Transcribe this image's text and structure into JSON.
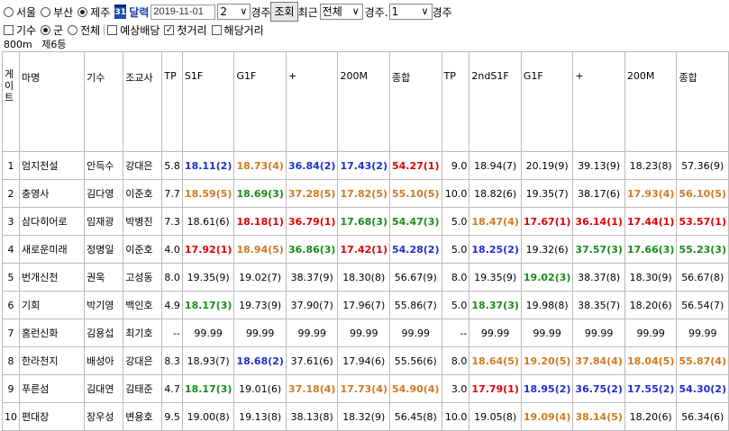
{
  "filters": {
    "regions": [
      "서울",
      "부산",
      "제주"
    ],
    "region_selected": "제주",
    "calendar_icon_text": "31",
    "calendar_link": "달력",
    "date": "2019-11-01",
    "race_no": "2",
    "race_suffix": "경주",
    "search_button": "조회",
    "recent_label": "최근",
    "recent_value": "전체",
    "race_count_label": "경주.",
    "race_count_value": "1",
    "race_count_suffix": "경주",
    "groups": [
      "기수",
      "군",
      "전체"
    ],
    "group_selected": "군",
    "checks": [
      {
        "label": "예상배당",
        "checked": false
      },
      {
        "label": "첫거리",
        "checked": true
      },
      {
        "label": "해당거리",
        "checked": false
      }
    ]
  },
  "race_info": {
    "distance": "800m",
    "grade": "제6등"
  },
  "colors": {
    "red": "#e00000",
    "orange": "#d07a20",
    "blue": "#1b2fd0",
    "green": "#1a8a1a",
    "normal": "#000000"
  },
  "table": {
    "headers": [
      "게이트",
      "마명",
      "기수",
      "조교사",
      "TP",
      "S1F",
      "G1F",
      "+",
      "200M",
      "종합",
      "TP",
      "2ndS1F",
      "G1F",
      "+",
      "200M",
      "종합"
    ],
    "rows": [
      {
        "gate": "1",
        "name": "엄지전설",
        "jockey": "안득수",
        "trainer": "강대은",
        "tp": "5.8",
        "tp2": "9.0",
        "cells": [
          [
            "18.11(2)",
            "blue"
          ],
          [
            "18.73(4)",
            "orange"
          ],
          [
            "36.84(2)",
            "blue"
          ],
          [
            "17.43(2)",
            "blue"
          ],
          [
            "54.27(1)",
            "red"
          ],
          [
            "18.94(7)",
            "normal"
          ],
          [
            "20.19(9)",
            "normal"
          ],
          [
            "39.13(9)",
            "normal"
          ],
          [
            "18.23(8)",
            "normal"
          ],
          [
            "57.36(9)",
            "normal"
          ]
        ]
      },
      {
        "gate": "2",
        "name": "충영사",
        "jockey": "김다영",
        "trainer": "이준호",
        "tp": "7.7",
        "tp2": "10.0",
        "cells": [
          [
            "18.59(5)",
            "orange"
          ],
          [
            "18.69(3)",
            "green"
          ],
          [
            "37.28(5)",
            "orange"
          ],
          [
            "17.82(5)",
            "orange"
          ],
          [
            "55.10(5)",
            "orange"
          ],
          [
            "18.82(6)",
            "normal"
          ],
          [
            "19.35(7)",
            "normal"
          ],
          [
            "38.17(6)",
            "normal"
          ],
          [
            "17.93(4)",
            "orange"
          ],
          [
            "56.10(5)",
            "orange"
          ]
        ]
      },
      {
        "gate": "3",
        "name": "삼다히어로",
        "jockey": "임재광",
        "trainer": "박병진",
        "tp": "7.3",
        "tp2": "5.0",
        "cells": [
          [
            "18.61(6)",
            "normal"
          ],
          [
            "18.18(1)",
            "red"
          ],
          [
            "36.79(1)",
            "red"
          ],
          [
            "17.68(3)",
            "green"
          ],
          [
            "54.47(3)",
            "green"
          ],
          [
            "18.47(4)",
            "orange"
          ],
          [
            "17.67(1)",
            "red"
          ],
          [
            "36.14(1)",
            "red"
          ],
          [
            "17.44(1)",
            "red"
          ],
          [
            "53.57(1)",
            "red"
          ]
        ]
      },
      {
        "gate": "4",
        "name": "새로운미래",
        "jockey": "정명일",
        "trainer": "이준호",
        "tp": "4.0",
        "tp2": "5.0",
        "cells": [
          [
            "17.92(1)",
            "red"
          ],
          [
            "18.94(5)",
            "orange"
          ],
          [
            "36.86(3)",
            "green"
          ],
          [
            "17.42(1)",
            "red"
          ],
          [
            "54.28(2)",
            "blue"
          ],
          [
            "18.25(2)",
            "blue"
          ],
          [
            "19.32(6)",
            "normal"
          ],
          [
            "37.57(3)",
            "green"
          ],
          [
            "17.66(3)",
            "green"
          ],
          [
            "55.23(3)",
            "green"
          ]
        ]
      },
      {
        "gate": "5",
        "name": "번개신천",
        "jockey": "권욱",
        "trainer": "고성동",
        "tp": "8.0",
        "tp2": "8.0",
        "cells": [
          [
            "19.35(9)",
            "normal"
          ],
          [
            "19.02(7)",
            "normal"
          ],
          [
            "38.37(9)",
            "normal"
          ],
          [
            "18.30(8)",
            "normal"
          ],
          [
            "56.67(9)",
            "normal"
          ],
          [
            "19.35(9)",
            "normal"
          ],
          [
            "19.02(3)",
            "green"
          ],
          [
            "38.37(8)",
            "normal"
          ],
          [
            "18.30(9)",
            "normal"
          ],
          [
            "56.67(8)",
            "normal"
          ]
        ]
      },
      {
        "gate": "6",
        "name": "기회",
        "jockey": "박기영",
        "trainer": "백인호",
        "tp": "4.9",
        "tp2": "5.0",
        "cells": [
          [
            "18.17(3)",
            "green"
          ],
          [
            "19.73(9)",
            "normal"
          ],
          [
            "37.90(7)",
            "normal"
          ],
          [
            "17.96(7)",
            "normal"
          ],
          [
            "55.86(7)",
            "normal"
          ],
          [
            "18.37(3)",
            "green"
          ],
          [
            "19.98(8)",
            "normal"
          ],
          [
            "38.35(7)",
            "normal"
          ],
          [
            "18.20(6)",
            "normal"
          ],
          [
            "56.54(7)",
            "normal"
          ]
        ]
      },
      {
        "gate": "7",
        "name": "홈런신화",
        "jockey": "김용섭",
        "trainer": "최기호",
        "tp": "--",
        "tp2": "--",
        "cells": [
          [
            "99.99",
            "normal"
          ],
          [
            "99.99",
            "normal"
          ],
          [
            "99.99",
            "normal"
          ],
          [
            "99.99",
            "normal"
          ],
          [
            "99.99",
            "normal"
          ],
          [
            "99.99",
            "normal"
          ],
          [
            "99.99",
            "normal"
          ],
          [
            "99.99",
            "normal"
          ],
          [
            "99.99",
            "normal"
          ],
          [
            "99.99",
            "normal"
          ]
        ]
      },
      {
        "gate": "8",
        "name": "한라천지",
        "jockey": "배성아",
        "trainer": "강대은",
        "tp": "8.3",
        "tp2": "8.0",
        "cells": [
          [
            "18.93(7)",
            "normal"
          ],
          [
            "18.68(2)",
            "blue"
          ],
          [
            "37.61(6)",
            "normal"
          ],
          [
            "17.94(6)",
            "normal"
          ],
          [
            "55.56(6)",
            "normal"
          ],
          [
            "18.64(5)",
            "orange"
          ],
          [
            "19.20(5)",
            "orange"
          ],
          [
            "37.84(4)",
            "orange"
          ],
          [
            "18.04(5)",
            "orange"
          ],
          [
            "55.87(4)",
            "orange"
          ]
        ]
      },
      {
        "gate": "9",
        "name": "푸른섬",
        "jockey": "김대연",
        "trainer": "김태준",
        "tp": "4.7",
        "tp2": "3.0",
        "cells": [
          [
            "18.17(3)",
            "green"
          ],
          [
            "19.01(6)",
            "normal"
          ],
          [
            "37.18(4)",
            "orange"
          ],
          [
            "17.73(4)",
            "orange"
          ],
          [
            "54.90(4)",
            "orange"
          ],
          [
            "17.79(1)",
            "red"
          ],
          [
            "18.95(2)",
            "blue"
          ],
          [
            "36.75(2)",
            "blue"
          ],
          [
            "17.55(2)",
            "blue"
          ],
          [
            "54.30(2)",
            "blue"
          ]
        ]
      },
      {
        "gate": "10",
        "name": "편대장",
        "jockey": "장우성",
        "trainer": "변용호",
        "tp": "9.5",
        "tp2": "10.0",
        "cells": [
          [
            "19.00(8)",
            "normal"
          ],
          [
            "19.13(8)",
            "normal"
          ],
          [
            "38.13(8)",
            "normal"
          ],
          [
            "18.32(9)",
            "normal"
          ],
          [
            "56.45(8)",
            "normal"
          ],
          [
            "19.05(8)",
            "normal"
          ],
          [
            "19.09(4)",
            "orange"
          ],
          [
            "38.14(5)",
            "orange"
          ],
          [
            "18.20(6)",
            "normal"
          ],
          [
            "56.34(6)",
            "normal"
          ]
        ]
      }
    ]
  }
}
